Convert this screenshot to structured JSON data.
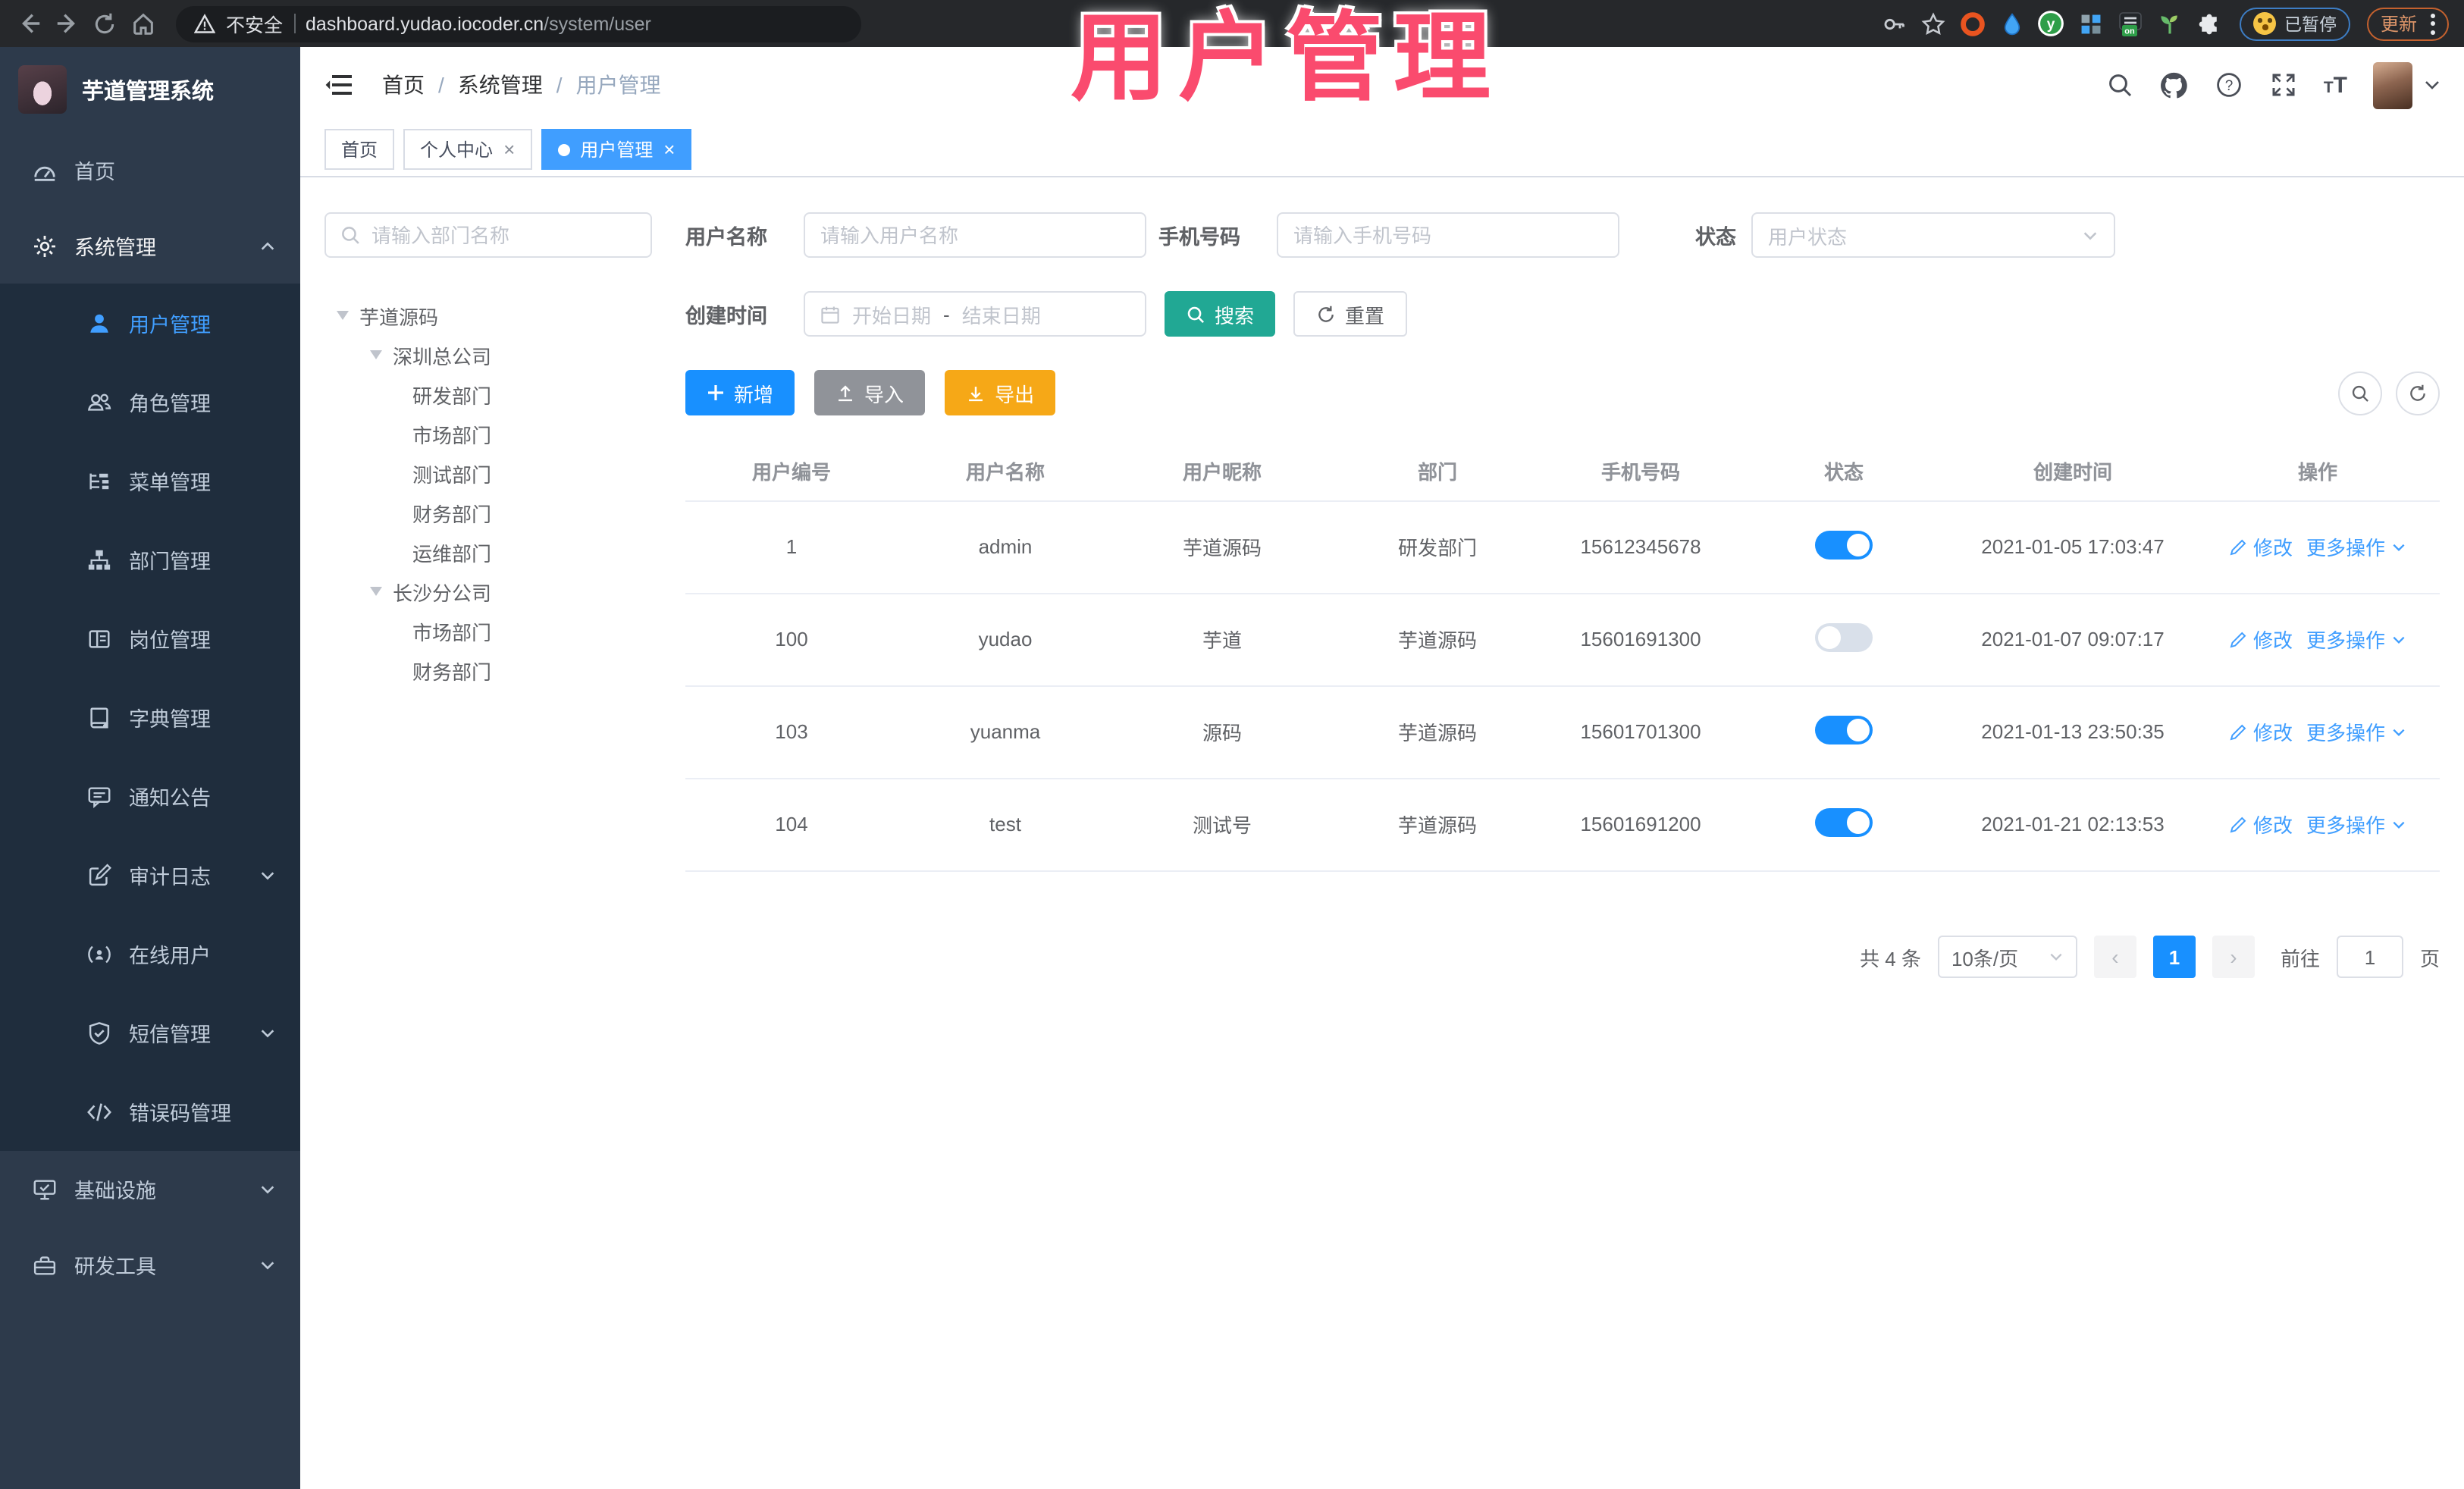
{
  "browser": {
    "security_label": "不安全",
    "url_host": "dashboard.yudao.iocoder.cn",
    "url_path": "/system/user",
    "paused_badge_label": "已暂停",
    "update_button_label": "更新"
  },
  "overlay_title": "用户管理",
  "header": {
    "app_title": "芋道管理系统",
    "breadcrumb": {
      "items": [
        "首页",
        "系统管理",
        "用户管理"
      ],
      "separator": "/"
    }
  },
  "tabs": [
    {
      "label": "首页"
    },
    {
      "label": "个人中心",
      "close": "×"
    },
    {
      "label": "用户管理",
      "close": "×",
      "active": true
    }
  ],
  "menu": [
    {
      "label": "首页",
      "icon": "dashboard-icon",
      "level": 1
    },
    {
      "label": "系统管理",
      "icon": "gear-icon",
      "level": 1,
      "expanded": true
    },
    {
      "label": "用户管理",
      "icon": "user-icon",
      "level": 2,
      "active": true
    },
    {
      "label": "角色管理",
      "icon": "roles-icon",
      "level": 2
    },
    {
      "label": "菜单管理",
      "icon": "menu-list-icon",
      "level": 2
    },
    {
      "label": "部门管理",
      "icon": "org-tree-icon",
      "level": 2
    },
    {
      "label": "岗位管理",
      "icon": "post-icon",
      "level": 2
    },
    {
      "label": "字典管理",
      "icon": "dict-icon",
      "level": 2
    },
    {
      "label": "通知公告",
      "icon": "notice-icon",
      "level": 2
    },
    {
      "label": "审计日志",
      "icon": "audit-icon",
      "level": 2,
      "collapsible": true
    },
    {
      "label": "在线用户",
      "icon": "online-user-icon",
      "level": 2
    },
    {
      "label": "短信管理",
      "icon": "sms-icon",
      "level": 2,
      "collapsible": true
    },
    {
      "label": "错误码管理",
      "icon": "error-code-icon",
      "level": 2
    },
    {
      "label": "基础设施",
      "icon": "infra-icon",
      "level": 1,
      "collapsible": true
    },
    {
      "label": "研发工具",
      "icon": "devtools-icon",
      "level": 1,
      "collapsible": true
    }
  ],
  "dept": {
    "search_placeholder": "请输入部门名称",
    "tree": [
      {
        "label": "芋道源码",
        "level": 1
      },
      {
        "label": "深圳总公司",
        "level": 2
      },
      {
        "label": "研发部门",
        "level": 3
      },
      {
        "label": "市场部门",
        "level": 3
      },
      {
        "label": "测试部门",
        "level": 3
      },
      {
        "label": "财务部门",
        "level": 3
      },
      {
        "label": "运维部门",
        "level": 3
      },
      {
        "label": "长沙分公司",
        "level": 2
      },
      {
        "label": "市场部门",
        "level": 3
      },
      {
        "label": "财务部门",
        "level": 3
      }
    ]
  },
  "filters": {
    "username_label": "用户名称",
    "username_placeholder": "请输入用户名称",
    "mobile_label": "手机号码",
    "mobile_placeholder": "请输入手机号码",
    "status_label": "状态",
    "status_placeholder": "用户状态",
    "create_time_label": "创建时间",
    "date_start_placeholder": "开始日期",
    "date_range_separator": "-",
    "date_end_placeholder": "结束日期",
    "search_label": "搜索",
    "reset_label": "重置"
  },
  "actions": {
    "add_label": "新增",
    "import_label": "导入",
    "export_label": "导出"
  },
  "table": {
    "columns": [
      "用户编号",
      "用户名称",
      "用户昵称",
      "部门",
      "手机号码",
      "状态",
      "创建时间",
      "操作"
    ],
    "edit_label": "修改",
    "more_label": "更多操作",
    "rows": [
      {
        "id": "1",
        "username": "admin",
        "nickname": "芋道源码",
        "dept": "研发部门",
        "mobile": "15612345678",
        "status": "on",
        "created": "2021-01-05 17:03:47"
      },
      {
        "id": "100",
        "username": "yudao",
        "nickname": "芋道",
        "dept": "芋道源码",
        "mobile": "15601691300",
        "status": "off",
        "created": "2021-01-07 09:07:17"
      },
      {
        "id": "103",
        "username": "yuanma",
        "nickname": "源码",
        "dept": "芋道源码",
        "mobile": "15601701300",
        "status": "on",
        "created": "2021-01-13 23:50:35"
      },
      {
        "id": "104",
        "username": "test",
        "nickname": "测试号",
        "dept": "芋道源码",
        "mobile": "15601691200",
        "status": "on",
        "created": "2021-01-21 02:13:53"
      }
    ]
  },
  "pagination": {
    "total_label": "共 4 条",
    "page_size_label": "10条/页",
    "prev_label": "‹",
    "current_page": "1",
    "next_label": "›",
    "goto_label": "前往",
    "goto_value": "1",
    "unit_label": "页"
  },
  "colors": {
    "primary_blue": "#409EFF",
    "solid_blue": "#1890FF",
    "search_teal": "#21A894",
    "export_amber": "#F6A817",
    "import_grey": "#909399",
    "overlay_pink": "#FA4B6E",
    "sidebar_bg": "#2D3A4B",
    "submenu_bg": "#1F2D3D"
  }
}
